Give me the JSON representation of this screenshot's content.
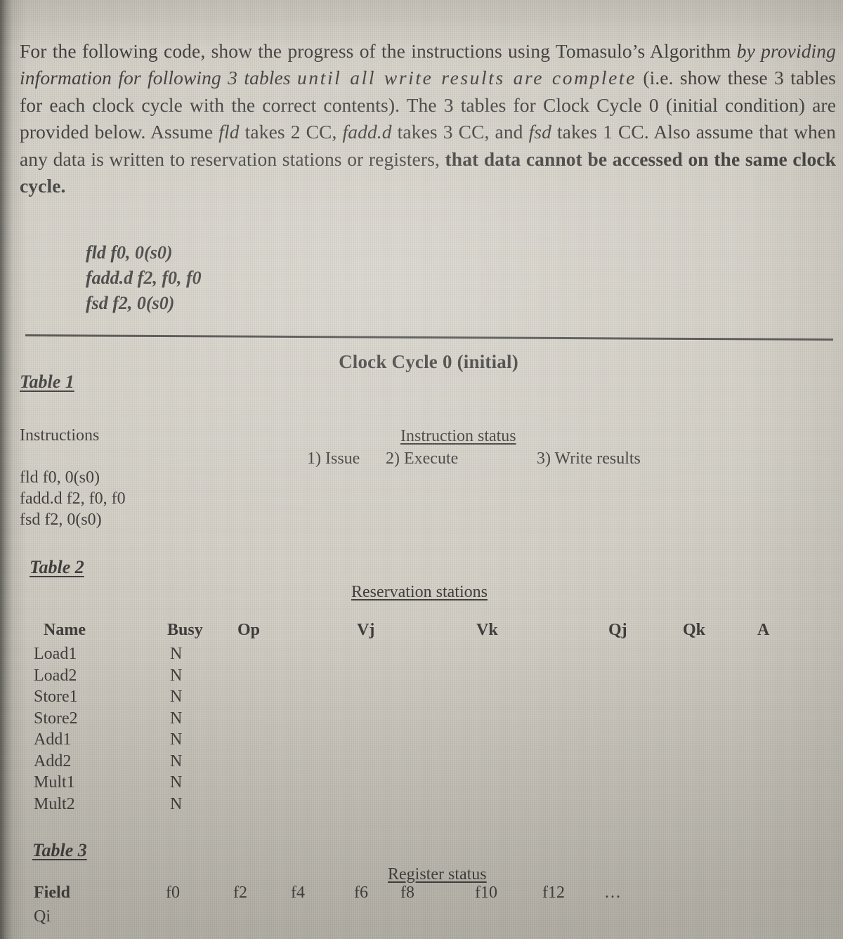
{
  "document": {
    "paper_color": "#cfcbc1",
    "ink_color": "#242220",
    "intro": {
      "seg1": "For the following code, show the progress of the instructions using Tomasulo’s Algorithm ",
      "seg2_italic": "by providing information for following 3 tables ",
      "seg3_italic_spaced": "until all write results are complete",
      "seg4": " (i.e. show these 3 tables for each clock cycle with the correct contents). The 3 tables for Clock Cycle 0 (initial condition) are provided below. Assume ",
      "seg5_italic": "fld",
      "seg6": " takes 2 CC, ",
      "seg7_italic": "fadd.d",
      "seg8": " takes 3 CC, and ",
      "seg9_italic": "fsd",
      "seg10": " takes 1 CC. Also assume that when any data is written to reservation stations or registers, ",
      "seg11_bold": "that data cannot be accessed on the same clock cycle."
    },
    "code_listing": [
      "fld f0, 0(s0)",
      "fadd.d f2, f0, f0",
      "fsd f2, 0(s0)"
    ],
    "clock_cycle_title": "Clock Cycle 0 (initial)"
  },
  "table1": {
    "label": "Table 1",
    "instructions_column_header": "Instructions",
    "status_heading": "Instruction status",
    "status_columns": [
      "1) Issue",
      "2) Execute",
      "3) Write results"
    ],
    "instruction_rows": [
      "fld f0, 0(s0)",
      "fadd.d f2, f0, f0",
      "fsd f2, 0(s0)"
    ]
  },
  "table2": {
    "label": "Table 2",
    "heading": "Reservation stations",
    "columns": [
      "Name",
      "Busy",
      "Op",
      "Vj",
      "Vk",
      "Qj",
      "Qk",
      "A"
    ],
    "rows": [
      {
        "name": "Load1",
        "busy": "N",
        "op": "",
        "vj": "",
        "vk": "",
        "qj": "",
        "qk": "",
        "a": ""
      },
      {
        "name": "Load2",
        "busy": "N",
        "op": "",
        "vj": "",
        "vk": "",
        "qj": "",
        "qk": "",
        "a": ""
      },
      {
        "name": "Store1",
        "busy": "N",
        "op": "",
        "vj": "",
        "vk": "",
        "qj": "",
        "qk": "",
        "a": ""
      },
      {
        "name": "Store2",
        "busy": "N",
        "op": "",
        "vj": "",
        "vk": "",
        "qj": "",
        "qk": "",
        "a": ""
      },
      {
        "name": "Add1",
        "busy": "N",
        "op": "",
        "vj": "",
        "vk": "",
        "qj": "",
        "qk": "",
        "a": ""
      },
      {
        "name": "Add2",
        "busy": "N",
        "op": "",
        "vj": "",
        "vk": "",
        "qj": "",
        "qk": "",
        "a": ""
      },
      {
        "name": "Mult1",
        "busy": "N",
        "op": "",
        "vj": "",
        "vk": "",
        "qj": "",
        "qk": "",
        "a": ""
      },
      {
        "name": "Mult2",
        "busy": "N",
        "op": "",
        "vj": "",
        "vk": "",
        "qj": "",
        "qk": "",
        "a": ""
      }
    ]
  },
  "table3": {
    "label": "Table 3",
    "heading": "Register status",
    "field_label": "Field",
    "registers": [
      "f0",
      "f2",
      "f4",
      "f6",
      "f8",
      "f10",
      "f12",
      "…"
    ],
    "qi_label": "Qi",
    "qi_values": [
      "",
      "",
      "",
      "",
      "",
      "",
      "",
      ""
    ]
  }
}
